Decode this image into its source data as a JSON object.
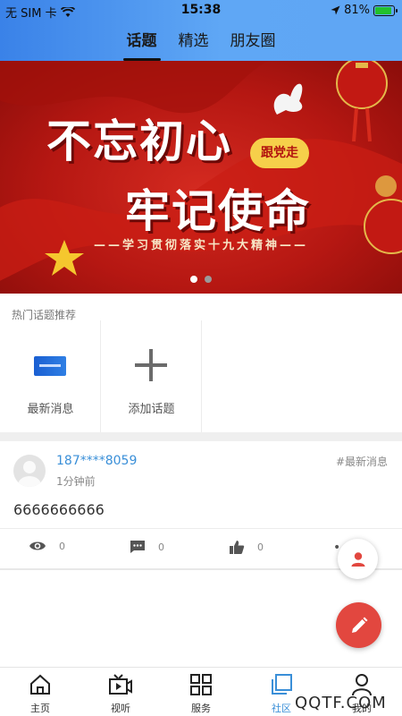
{
  "status_bar": {
    "carrier": "无 SIM 卡",
    "time": "15:38",
    "battery": "81%"
  },
  "top_tabs": [
    {
      "label": "话题",
      "active": true
    },
    {
      "label": "精选",
      "active": false
    },
    {
      "label": "朋友圈",
      "active": false
    }
  ],
  "banner": {
    "title_line1": "不忘初心",
    "title_line2": "牢记使命",
    "badge": "跟党走",
    "slogan": "——学习贯彻落实十九大精神——",
    "slide_count": 2,
    "active_slide": 1
  },
  "hot_topics": {
    "title": "热门话题推荐",
    "items": [
      {
        "label": "最新消息",
        "icon": "news-thumbnail"
      },
      {
        "label": "添加话题",
        "icon": "plus-icon"
      }
    ]
  },
  "post": {
    "username": "187****8059",
    "time": "1分钟前",
    "tag": "#最新消息",
    "content": "6666666666",
    "views": "0",
    "comments": "0",
    "likes": "0",
    "more": "••"
  },
  "bottom_nav": [
    {
      "label": "主页",
      "icon": "home-icon",
      "active": false
    },
    {
      "label": "视听",
      "icon": "video-icon",
      "active": false
    },
    {
      "label": "服务",
      "icon": "grid-icon",
      "active": false
    },
    {
      "label": "社区",
      "icon": "community-icon",
      "active": true
    },
    {
      "label": "我的",
      "icon": "user-icon",
      "active": false
    }
  ],
  "watermark": "QQTF.COM",
  "colors": {
    "accent": "#3a8fd8",
    "fab_red": "#e2473f",
    "header_blue": "#4b93ec"
  }
}
